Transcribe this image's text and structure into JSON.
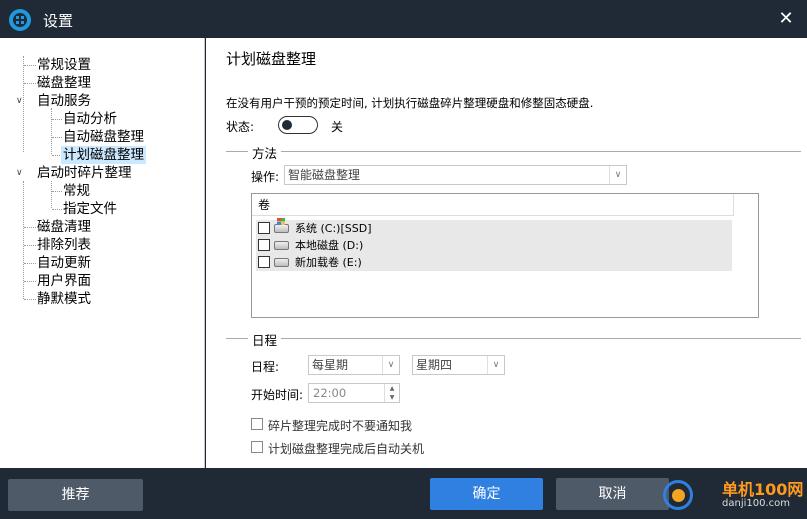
{
  "window": {
    "title": "设置"
  },
  "sidebar": {
    "items": [
      {
        "label": "常规设置"
      },
      {
        "label": "磁盘整理"
      },
      {
        "label": "自动服务",
        "toggle": "∨"
      },
      {
        "label": "自动分析"
      },
      {
        "label": "自动磁盘整理"
      },
      {
        "label": "计划磁盘整理",
        "selected": true
      },
      {
        "label": "启动时碎片整理",
        "toggle": "∨"
      },
      {
        "label": "常规"
      },
      {
        "label": "指定文件"
      },
      {
        "label": "磁盘清理"
      },
      {
        "label": "排除列表"
      },
      {
        "label": "自动更新"
      },
      {
        "label": "用户界面"
      },
      {
        "label": "静默模式"
      }
    ]
  },
  "main": {
    "title": "计划磁盘整理",
    "description": "在没有用户干预的预定时间, 计划执行磁盘碎片整理硬盘和修整固态硬盘.",
    "status_label": "状态:",
    "status_value": "关",
    "method_group": "方法",
    "operation_label": "操作:",
    "operation_value": "智能磁盘整理",
    "volume_header": "卷",
    "volumes": [
      {
        "label": "系统 (C:)[SSD]",
        "checked": false,
        "icon": "system-drive-icon"
      },
      {
        "label": "本地磁盘 (D:)",
        "checked": false,
        "icon": "hard-drive-icon"
      },
      {
        "label": "新加载卷 (E:)",
        "checked": false,
        "icon": "hard-drive-icon"
      }
    ],
    "schedule_group": "日程",
    "schedule_label": "日程:",
    "schedule_value": "每星期",
    "weekday_value": "星期四",
    "start_time_label": "开始时间:",
    "start_time_value": "22:00",
    "no_notify_label": "碎片整理完成时不要通知我",
    "auto_shutdown_label": "计划磁盘整理完成后自动关机"
  },
  "footer": {
    "recommend": "推荐",
    "ok": "确定",
    "cancel": "取消"
  },
  "watermark": {
    "text": "单机100网",
    "url": "danji100.com"
  },
  "colors": {
    "titlebar": "#1f2a36",
    "primary_button": "#2f80e0",
    "secondary_button": "#4e5a68",
    "selection": "#cce8ff"
  }
}
